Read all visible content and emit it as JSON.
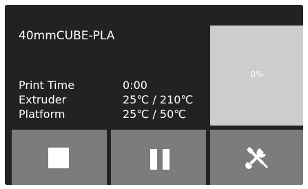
{
  "job": {
    "name": "40mmCUBE-PLA"
  },
  "stats": [
    {
      "label": "Print Time",
      "value": "0:00"
    },
    {
      "label": "Extruder",
      "value": "25℃ / 210℃"
    },
    {
      "label": "Platform",
      "value": "25℃ / 50℃"
    }
  ],
  "preview": {
    "progress_text": "0%",
    "progress_value": 0
  },
  "buttons": {
    "stop_icon": "stop-icon",
    "pause_icon": "pause-icon",
    "tools_icon": "tools-icon"
  },
  "colors": {
    "screen_bg": "#222222",
    "button_bg": "#7c7c7c",
    "preview_bg": "#cdcdcd",
    "text": "#ffffff"
  }
}
